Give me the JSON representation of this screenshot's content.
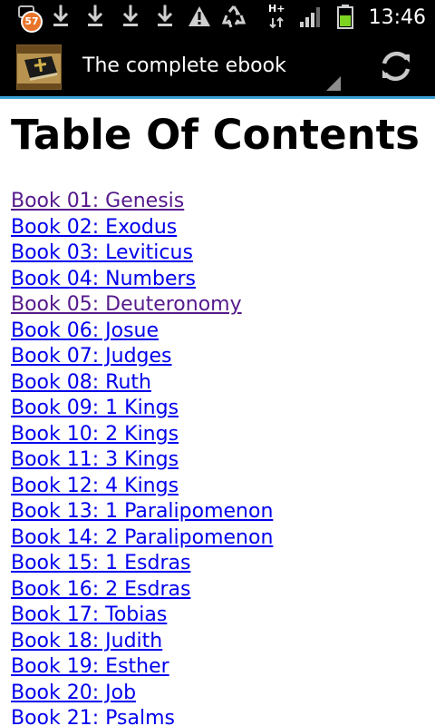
{
  "status_bar": {
    "notification_count": "57",
    "network_label": "H+",
    "clock": "13:46",
    "icons": [
      "notification-icon",
      "download-icon",
      "download-icon",
      "download-icon",
      "download-icon",
      "warning-icon",
      "recycle-icon",
      "signal-icon",
      "battery-icon"
    ],
    "battery_color": "#7ed321"
  },
  "action_bar": {
    "title": "The complete ebook",
    "accent_color": "#3a9fd5",
    "refresh_icon": "refresh-icon"
  },
  "content": {
    "title": "Table Of Contents",
    "link_color": "#0000ee",
    "visited_color": "#551a8b",
    "books": [
      {
        "label": "Book 01: Genesis",
        "visited": true
      },
      {
        "label": "Book 02: Exodus",
        "visited": false
      },
      {
        "label": "Book 03: Leviticus",
        "visited": false
      },
      {
        "label": "Book 04: Numbers",
        "visited": false
      },
      {
        "label": "Book 05: Deuteronomy",
        "visited": true
      },
      {
        "label": "Book 06: Josue",
        "visited": false
      },
      {
        "label": "Book 07: Judges",
        "visited": false
      },
      {
        "label": "Book 08: Ruth",
        "visited": false
      },
      {
        "label": "Book 09: 1 Kings",
        "visited": false
      },
      {
        "label": "Book 10: 2 Kings",
        "visited": false
      },
      {
        "label": "Book 11: 3 Kings",
        "visited": false
      },
      {
        "label": "Book 12: 4 Kings",
        "visited": false
      },
      {
        "label": "Book 13: 1 Paralipomenon",
        "visited": false
      },
      {
        "label": "Book 14: 2 Paralipomenon",
        "visited": false
      },
      {
        "label": "Book 15: 1 Esdras",
        "visited": false
      },
      {
        "label": "Book 16: 2 Esdras",
        "visited": false
      },
      {
        "label": "Book 17: Tobias",
        "visited": false
      },
      {
        "label": "Book 18: Judith",
        "visited": false
      },
      {
        "label": "Book 19: Esther",
        "visited": false
      },
      {
        "label": "Book 20: Job",
        "visited": false
      },
      {
        "label": "Book 21: Psalms",
        "visited": false
      }
    ]
  }
}
